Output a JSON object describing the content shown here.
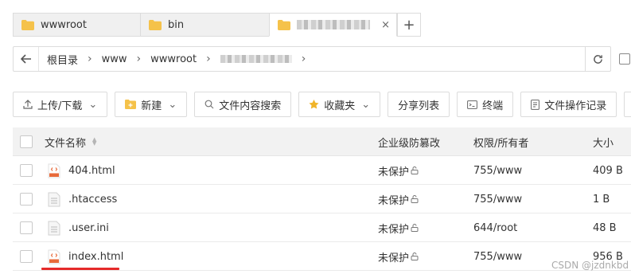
{
  "tabs": [
    {
      "label": "wwwroot",
      "active": false
    },
    {
      "label": "bin",
      "active": false
    },
    {
      "label": "",
      "active": true,
      "close": "×"
    }
  ],
  "tab_add": "+",
  "breadcrumb": [
    "根目录",
    "www",
    "wwwroot"
  ],
  "toolbar": {
    "upload": "上传/下载",
    "new": "新建",
    "search": "文件内容搜索",
    "favorites": "收藏夹",
    "share": "分享列表",
    "terminal": "终端",
    "oplog": "文件操作记录"
  },
  "table": {
    "headers": {
      "name": "文件名称",
      "protect": "企业级防篡改",
      "perm": "权限/所有者",
      "size": "大小"
    },
    "rows": [
      {
        "name": "404.html",
        "type": "html",
        "protect": "未保护",
        "perm": "755/www",
        "size": "409 B"
      },
      {
        "name": ".htaccess",
        "type": "file",
        "protect": "未保护",
        "perm": "755/www",
        "size": "1 B"
      },
      {
        "name": ".user.ini",
        "type": "file",
        "protect": "未保护",
        "perm": "644/root",
        "size": "48 B"
      },
      {
        "name": "index.html",
        "type": "html",
        "protect": "未保护",
        "perm": "755/www",
        "size": "956 B"
      }
    ]
  },
  "watermark": "CSDN @jzdnkbd",
  "colors": {
    "folder": "#f5c24a",
    "html_icon": "#e86a3a",
    "highlight": "#e52a2a"
  }
}
